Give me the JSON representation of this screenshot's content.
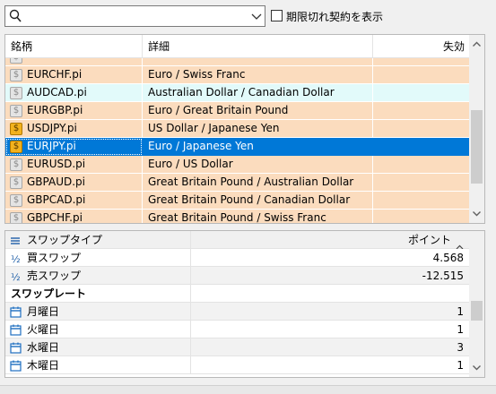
{
  "search": {
    "value": "",
    "placeholder": ""
  },
  "expired": {
    "label": "期限切れ契約を表示",
    "checked": false
  },
  "symbols": {
    "columns": [
      "銘柄",
      "詳細",
      "失効"
    ],
    "rows": [
      {
        "name": "",
        "desc": "",
        "icon": "gray",
        "style": "peach",
        "partial": true
      },
      {
        "name": "EURCHF.pi",
        "desc": "Euro / Swiss Franc",
        "icon": "gray",
        "style": "peach"
      },
      {
        "name": "AUDCAD.pi",
        "desc": "Australian Dollar / Canadian Dollar",
        "icon": "gray",
        "style": "cyan"
      },
      {
        "name": "EURGBP.pi",
        "desc": "Euro / Great Britain Pound",
        "icon": "gray",
        "style": "peach"
      },
      {
        "name": "USDJPY.pi",
        "desc": "US Dollar / Japanese Yen",
        "icon": "gold",
        "style": "peach"
      },
      {
        "name": "EURJPY.pi",
        "desc": "Euro / Japanese Yen",
        "icon": "gold",
        "style": "selected"
      },
      {
        "name": "EURUSD.pi",
        "desc": "Euro / US Dollar",
        "icon": "gray",
        "style": "peach"
      },
      {
        "name": "GBPAUD.pi",
        "desc": "Great Britain Pound / Australian Dollar",
        "icon": "gray",
        "style": "peach"
      },
      {
        "name": "GBPCAD.pi",
        "desc": "Great Britain Pound / Canadian Dollar",
        "icon": "gray",
        "style": "peach"
      },
      {
        "name": "GBPCHF.pi",
        "desc": "Great Britain Pound / Swiss Franc",
        "icon": "gray",
        "style": "peach"
      },
      {
        "name": "",
        "desc": "",
        "icon": "gray",
        "style": "peach",
        "partial": true
      }
    ]
  },
  "swap": {
    "header": {
      "key": "スワップタイプ",
      "value": "ポイント"
    },
    "rows": [
      {
        "key": "買スワップ",
        "value": "4.568",
        "icon": "half",
        "style": "white"
      },
      {
        "key": "売スワップ",
        "value": "-12.515",
        "icon": "half",
        "style": "gray"
      },
      {
        "key": "スワップレート",
        "value": "",
        "icon": "none",
        "style": "section"
      },
      {
        "key": "月曜日",
        "value": "1",
        "icon": "calendar",
        "style": "gray"
      },
      {
        "key": "火曜日",
        "value": "1",
        "icon": "calendar",
        "style": "white"
      },
      {
        "key": "水曜日",
        "value": "3",
        "icon": "calendar",
        "style": "gray"
      },
      {
        "key": "木曜日",
        "value": "1",
        "icon": "calendar",
        "style": "white"
      }
    ]
  },
  "colors": {
    "peach": "#fbdcbe",
    "cyan": "#e2fafa",
    "selected": "#0078d7",
    "gold": "#f3b21d"
  }
}
